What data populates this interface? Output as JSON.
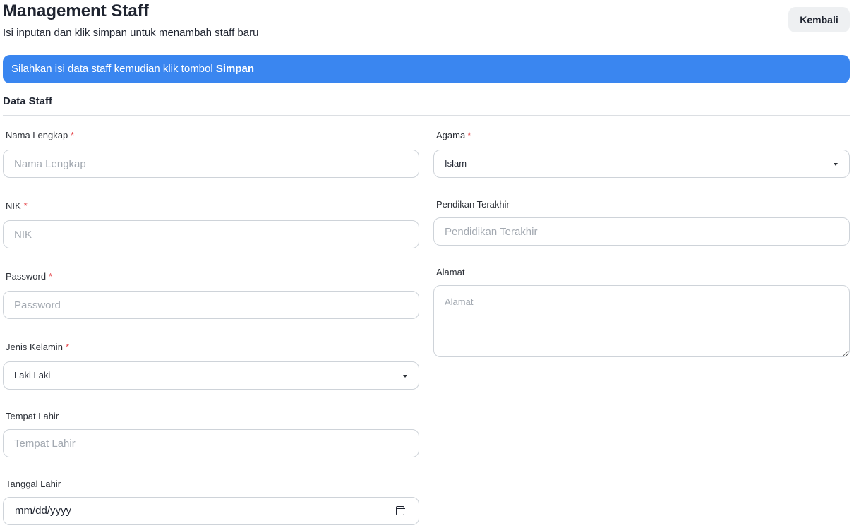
{
  "header": {
    "title": "Management Staff",
    "subtitle": "Isi inputan dan klik simpan untuk menambah staff baru",
    "back_label": "Kembali"
  },
  "alert": {
    "text": "Silahkan isi data staff kemudian klik tombol",
    "emphasis": "Simpan",
    "color": "#3a86f0"
  },
  "section": {
    "title": "Data Staff"
  },
  "form": {
    "nama": {
      "label": "Nama Lengkap",
      "required": "*",
      "placeholder": "Nama Lengkap"
    },
    "nik": {
      "label": "NIK",
      "required": "*",
      "placeholder": "NIK"
    },
    "password": {
      "label": "Password",
      "required": "*",
      "placeholder": "Password"
    },
    "jenis_kelamin": {
      "label": "Jenis Kelamin",
      "required": "*",
      "value": "Laki Laki"
    },
    "tempat_lahir": {
      "label": "Tempat Lahir",
      "placeholder": "Tempat Lahir"
    },
    "tanggal_lahir": {
      "label": "Tanggal Lahir",
      "value": "mm/dd/yyyy",
      "icon": "calendar-icon"
    },
    "agama": {
      "label": "Agama",
      "required": "*",
      "value": "Islam"
    },
    "pendidikan": {
      "label": "Pendikan Terakhir",
      "placeholder": "Pendidikan Terakhir"
    },
    "alamat": {
      "label": "Alamat",
      "placeholder": "Alamat"
    }
  }
}
